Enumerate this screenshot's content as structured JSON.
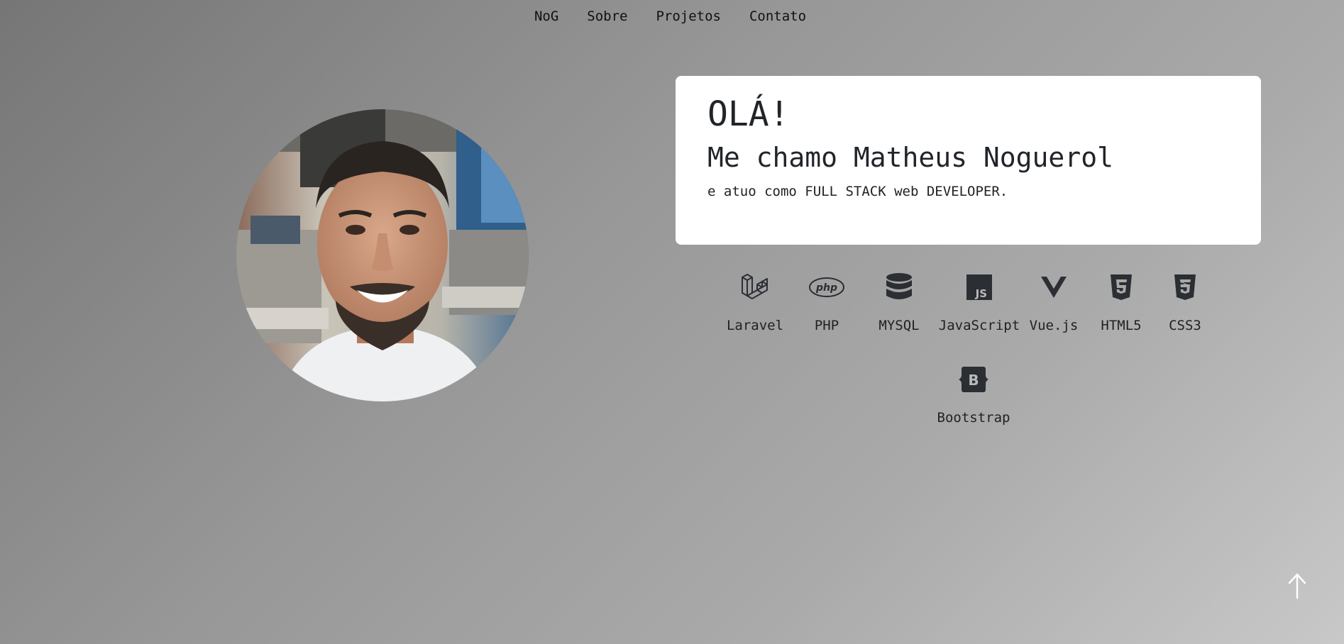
{
  "nav": {
    "items": [
      {
        "label": "NoG"
      },
      {
        "label": "Sobre"
      },
      {
        "label": "Projetos"
      },
      {
        "label": "Contato"
      }
    ]
  },
  "hero": {
    "greeting": "OLÁ!",
    "name_line": "Me chamo Matheus Noguerol",
    "role_line": "e atuo como FULL STACK web DEVELOPER."
  },
  "skills": [
    {
      "label": "Laravel",
      "icon": "laravel-icon"
    },
    {
      "label": "PHP",
      "icon": "php-icon"
    },
    {
      "label": "MYSQL",
      "icon": "database-icon"
    },
    {
      "label": "JavaScript",
      "icon": "javascript-icon"
    },
    {
      "label": "Vue.js",
      "icon": "vue-icon"
    },
    {
      "label": "HTML5",
      "icon": "html5-icon"
    },
    {
      "label": "CSS3",
      "icon": "css3-icon"
    },
    {
      "label": "Bootstrap",
      "icon": "bootstrap-icon"
    }
  ],
  "colors": {
    "card_background": "#ffffff",
    "text": "#212529",
    "icon": "#2b2e33"
  }
}
